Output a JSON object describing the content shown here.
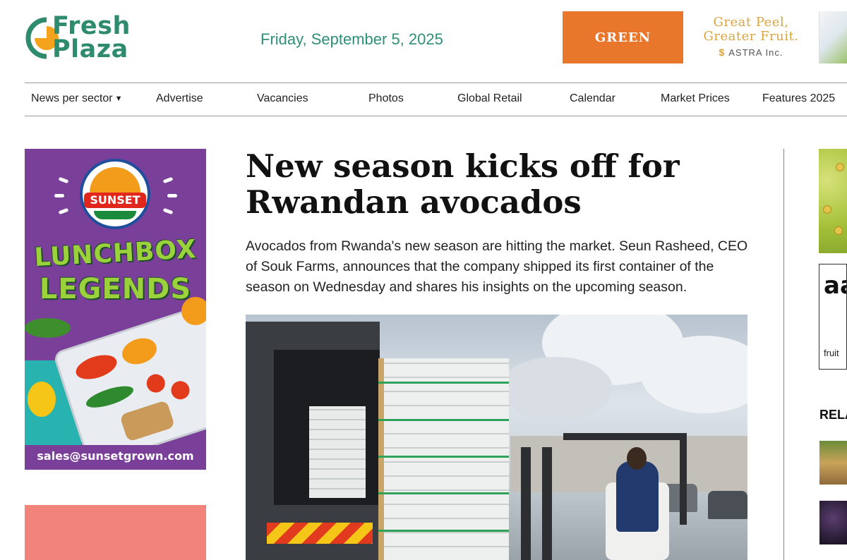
{
  "logo": {
    "line1": "Fresh",
    "line2": "Plaza"
  },
  "header": {
    "date": "Friday, September 5, 2025"
  },
  "ads": {
    "top_green": "GREEN",
    "top_peel_line1": "Great Peel,",
    "top_peel_line2": "Greater Fruit.",
    "top_peel_brand": "ASTRA Inc.",
    "left_brand": "SUNSET",
    "left_title1": "LUNCHBOX",
    "left_title2": "LEGENDS",
    "left_email": "sales@sunsetgrown.com",
    "right_aa": "aa",
    "right_fruit": "fruit"
  },
  "nav": {
    "items": [
      {
        "label": "News per sector",
        "has_dropdown": true
      },
      {
        "label": "Advertise"
      },
      {
        "label": "Vacancies"
      },
      {
        "label": "Photos"
      },
      {
        "label": "Global Retail"
      },
      {
        "label": "Calendar"
      },
      {
        "label": "Market Prices"
      },
      {
        "label": "Features 2025"
      }
    ],
    "caret": "▼"
  },
  "article": {
    "headline": "New season kicks off for Rwandan avocados",
    "lead": "Avocados from Rwanda's new season are hitting the market. Seun Rasheed, CEO of Souk Farms, announces that the company shipped its first container of the season on Wednesday and shares his insights on the upcoming season."
  },
  "sidebar": {
    "related_title": "RELA"
  },
  "colors": {
    "brand_green": "#2e8b6e",
    "date_color": "#2f8f78",
    "ad_orange": "#e8762b",
    "ad_gold": "#d9a441",
    "ad_purple": "#7a3f98"
  }
}
